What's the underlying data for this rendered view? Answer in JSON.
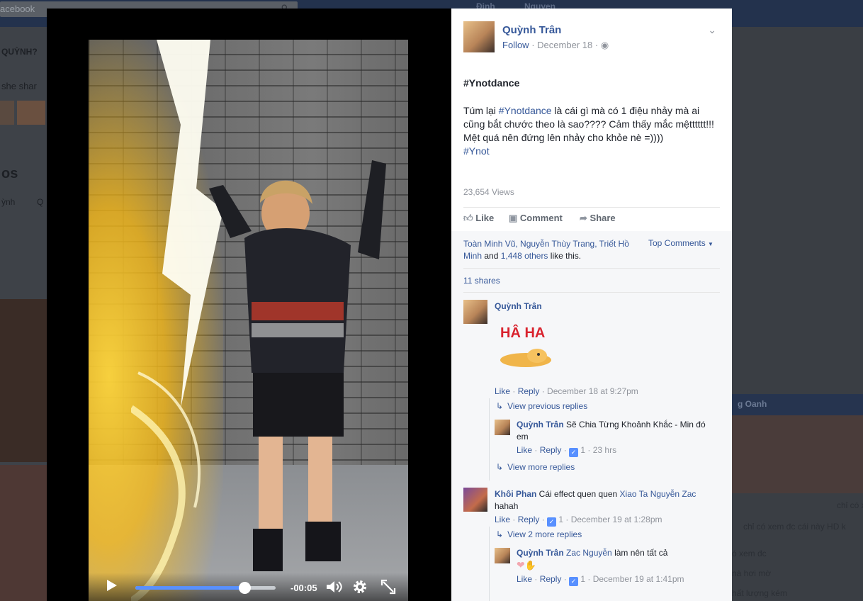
{
  "background": {
    "search_placeholder": "acebook",
    "left_texts": [
      "QUỲNH?",
      "she shar",
      "os",
      "ỳnh",
      "Q"
    ],
    "right_chat_name": "g Oanh",
    "right_texts": [
      "chỉ có xem",
      "chỉ có xem đc cái này HD k",
      "ó xem đc",
      "nà hơi mờ",
      "hất lượng kém"
    ],
    "top_texts": [
      "Đinh",
      "Nguyen"
    ]
  },
  "video": {
    "time_remaining": "-00:05",
    "progress_fraction": 0.78,
    "icons": [
      "play-icon",
      "volume-icon",
      "gear-icon",
      "fullscreen-icon"
    ]
  },
  "post": {
    "author": "Quỳnh Trân",
    "follow": "Follow",
    "date": "December 18",
    "separator": "·",
    "title": "#Ynotdance",
    "body_prefix": "Túm lại ",
    "body_hashtag": "#Ynotdance",
    "body_rest": " là cái gì mà có 1 điệu nhảy mà ai cũng bắt chước theo là sao???? Cảm thấy mắc mệtttttt!!! Mệt quá nên đứng lên nhảy cho khỏe nè =))))",
    "body_tag2": "#Ynot",
    "views": "23,654 Views",
    "actions": {
      "like": "Like",
      "comment": "Comment",
      "share": "Share"
    }
  },
  "reactions": {
    "names": "Toàn Minh Vũ, Nguyễn Thùy Trang, Triết Hồ Minh",
    "and": " and ",
    "others": "1,448 others",
    "suffix": " like this.",
    "top_comments": "Top Comments",
    "shares": "11 shares"
  },
  "comments": [
    {
      "name": "Quỳnh Trân",
      "sticker_text": "HÂ HA",
      "like": "Like",
      "reply": "Reply",
      "time": "December 18 at 9:27pm",
      "view_previous": "View previous replies",
      "reply_item": {
        "name": "Quỳnh Trân",
        "text": " Sẽ Chia Từng Khoảnh Khắc - Min đó em",
        "like": "Like",
        "reply": "Reply",
        "likes": "1",
        "time": "23 hrs"
      },
      "view_more": "View more replies"
    },
    {
      "name": "Khôi Phan",
      "text_prefix": " Cái effect quen quen ",
      "mention": "Xiao Ta Nguyễn Zac",
      "text_suffix": " hahah",
      "like": "Like",
      "reply": "Reply",
      "likes": "1",
      "time": "December 19 at 1:28pm",
      "view_more": "View 2 more replies",
      "reply_item": {
        "name": "Quỳnh Trân",
        "mention": "Zac Nguyễn",
        "text": " làm nên tất cả",
        "like": "Like",
        "reply": "Reply",
        "likes": "1",
        "time": "December 19 at 1:41pm"
      }
    }
  ],
  "colors": {
    "link": "#365899",
    "muted": "#90949c",
    "accent": "#5890ff"
  }
}
